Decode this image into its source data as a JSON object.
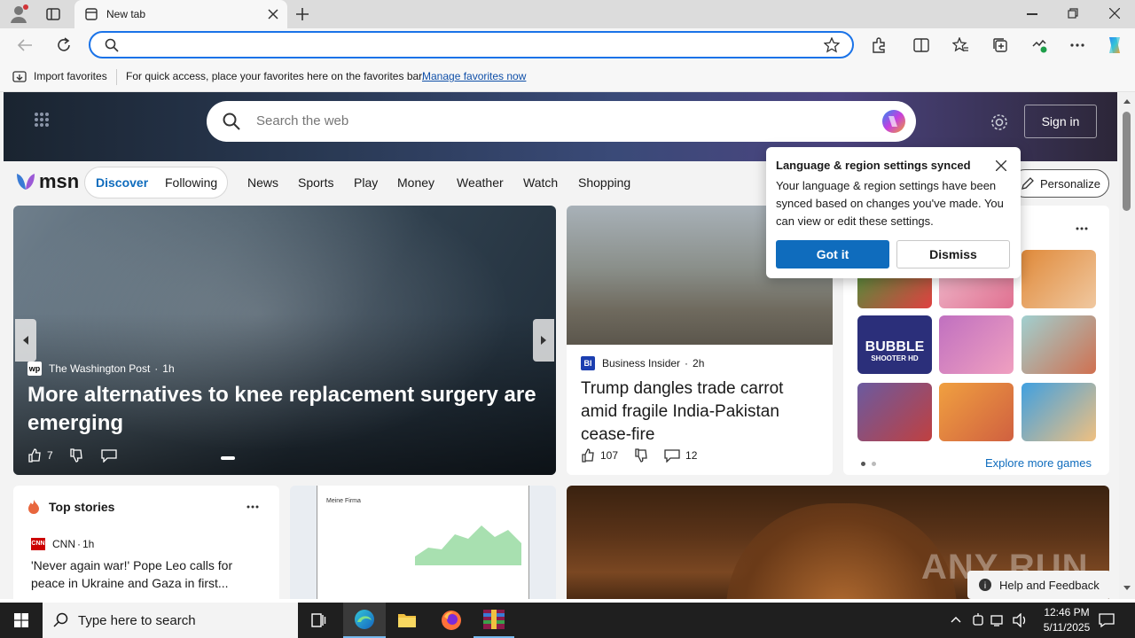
{
  "browser": {
    "tab_title": "New tab",
    "address_placeholder": "",
    "favorites_bar": {
      "import_label": "Import favorites",
      "hint": "For quick access, place your favorites here on the favorites bar.",
      "manage_link": "Manage favorites now"
    }
  },
  "msn": {
    "search_placeholder": "Search the web",
    "sign_in": "Sign in",
    "logo": "msn",
    "tabs": [
      "Discover",
      "Following"
    ],
    "nav": [
      "News",
      "Sports",
      "Play",
      "Money",
      "Weather",
      "Watch",
      "Shopping"
    ],
    "personalize": "Personalize",
    "main_story": {
      "source": "The Washington Post",
      "time": "1h",
      "headline": "More alternatives to knee replacement surgery are emerging",
      "likes": "7"
    },
    "second_story": {
      "source": "Business Insider",
      "time": "2h",
      "headline": "Trump dangles trade carrot amid fragile India-Pakistan cease-fire",
      "likes": "107",
      "comments": "12"
    },
    "games": {
      "explore": "Explore more games",
      "bubble_title": "BUBBLE",
      "bubble_sub": "SHOOTER HD"
    },
    "top_stories": {
      "title": "Top stories",
      "source": "CNN",
      "time": "1h",
      "headline": "'Never again war!' Pope Leo calls for peace in Ukraine and Gaza in first..."
    },
    "ad": {
      "company": "Meine Firma"
    },
    "popup": {
      "title": "Language & region settings synced",
      "body": "Your language & region settings have been synced based on changes you've made. You can view or edit these settings.",
      "got_it": "Got it",
      "dismiss": "Dismiss"
    },
    "feedback": "Help and Feedback",
    "watermark": "ANY RUN"
  },
  "taskbar": {
    "search_placeholder": "Type here to search",
    "time": "12:46 PM",
    "date": "5/11/2025"
  },
  "colors": {
    "accent": "#0f6cbd",
    "address_border": "#1a73e8",
    "taskbar": "#1f1f1f"
  }
}
